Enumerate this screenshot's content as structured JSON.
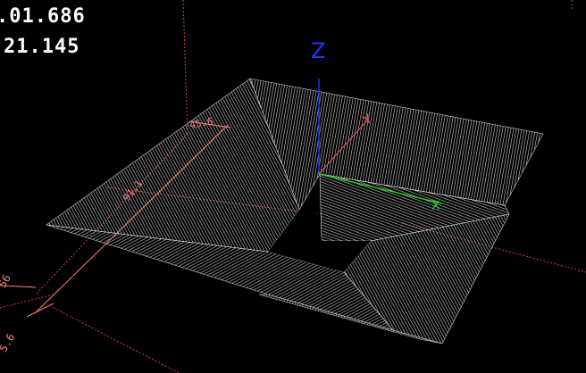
{
  "readouts": {
    "line1": ".01.686",
    "line2": "21.145"
  },
  "axes": {
    "z_label": "Z",
    "y_label": "Y",
    "x_label": "X"
  },
  "dimensions": {
    "label_top": "45.6",
    "label_diag": "91.1",
    "label_left_upper": "56",
    "label_left_lower": "5.6"
  },
  "colors": {
    "background": "#000000",
    "mesh": "#e6e6e6",
    "z_axis": "#2233ff",
    "x_axis": "#22cc22",
    "y_axis": "#ff5555",
    "guides": "#ff7a7a",
    "readout_text": "#ffffff"
  }
}
